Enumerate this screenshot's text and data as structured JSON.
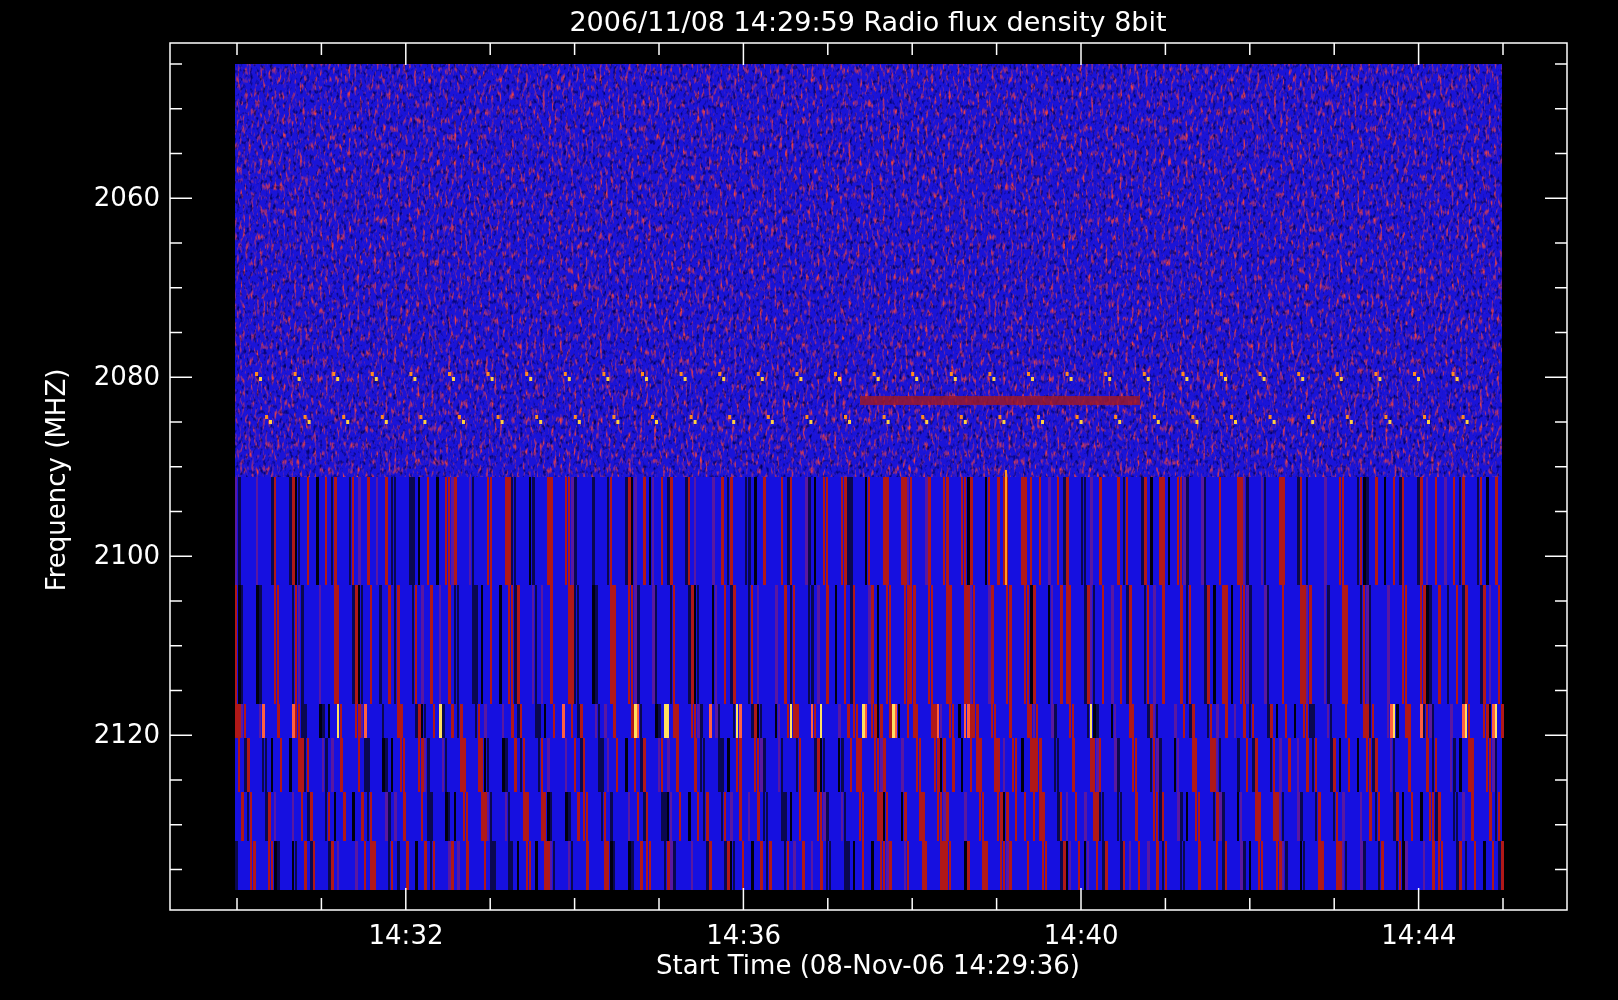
{
  "title": "2006/11/08 14:29:59 Radio flux density 8bit",
  "ylabel": "Frequency (MHZ)",
  "xlabel": "Start Time (08-Nov-06 14:29:36)",
  "yticks": [
    "2060",
    "2080",
    "2100",
    "2120"
  ],
  "xticks": [
    "14:32",
    "14:36",
    "14:40",
    "14:44"
  ]
}
